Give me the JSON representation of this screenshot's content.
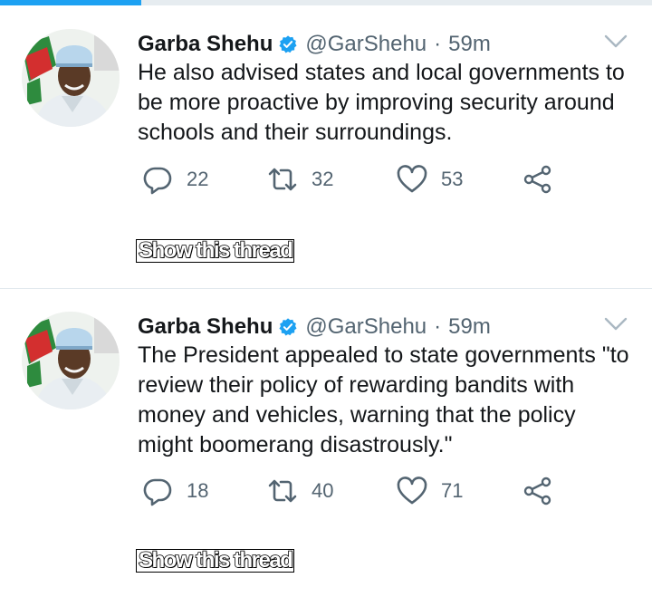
{
  "colors": {
    "accent": "#1da1f2",
    "icon_gray": "#536471",
    "divider": "#e1e8ed"
  },
  "tweets": [
    {
      "author_name": "Garba Shehu",
      "handle": "@GarShehu",
      "separator": "·",
      "time": "59m",
      "text": "He also advised states and local governments to be more proactive by improving security around schools and their surroundings.",
      "replies": "22",
      "retweets": "32",
      "likes": "53",
      "show_thread_label": "Show this thread"
    },
    {
      "author_name": "Garba Shehu",
      "handle": "@GarShehu",
      "separator": "·",
      "time": "59m",
      "text": "The President appealed to state governments \"to review their policy of rewarding bandits with money and vehicles, warning that the policy might boomerang disastrously.\"",
      "replies": "18",
      "retweets": "40",
      "likes": "71",
      "show_thread_label": "Show this thread"
    }
  ],
  "icons": {
    "verified": "verified-badge-icon",
    "more": "chevron-down-icon",
    "reply": "reply-icon",
    "retweet": "retweet-icon",
    "like": "heart-icon",
    "share": "share-icon"
  }
}
